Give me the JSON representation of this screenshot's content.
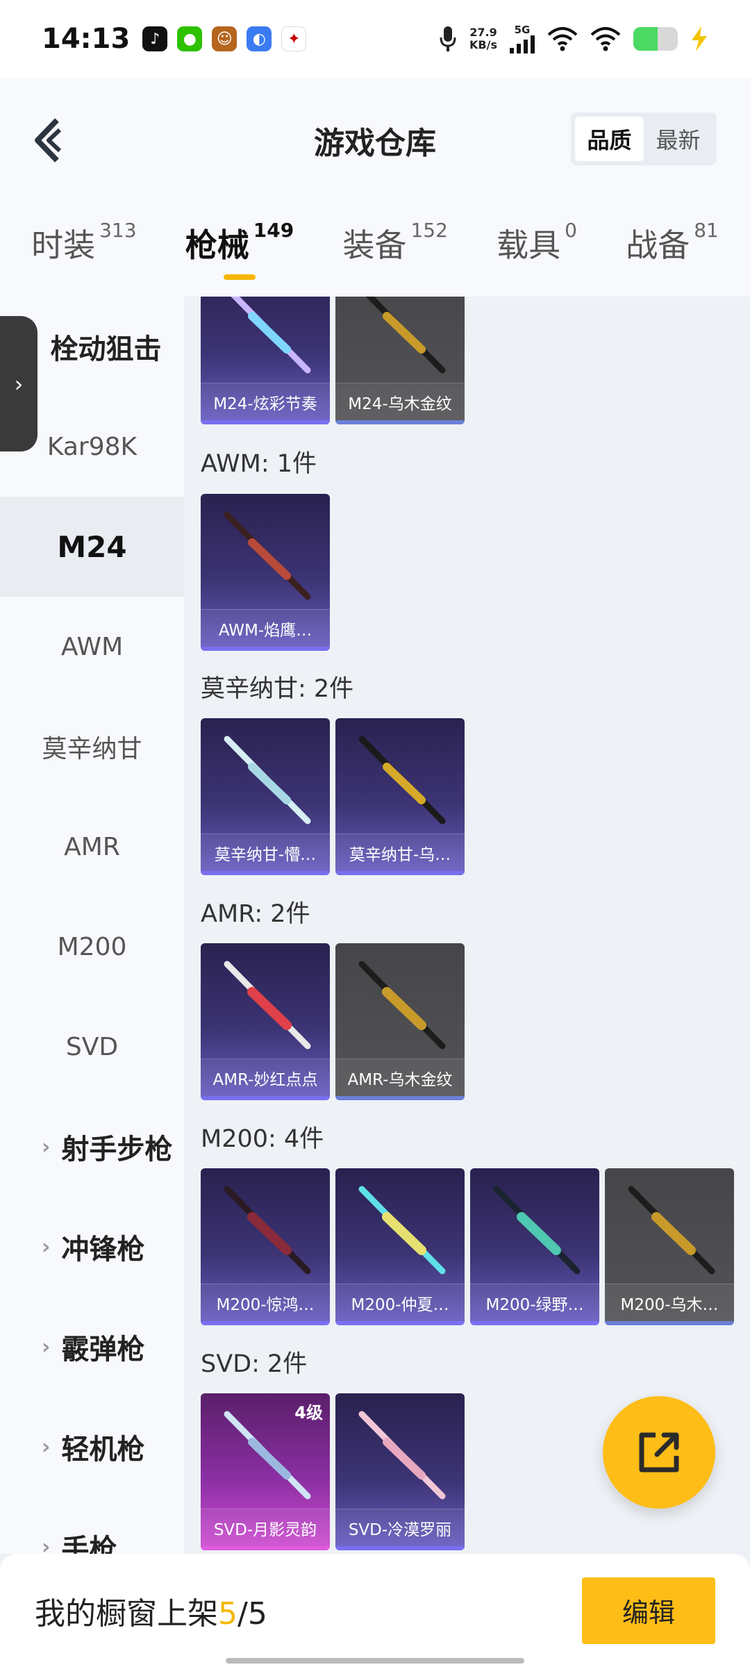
{
  "status_bar": {
    "time": "14:13",
    "net_speed_value": "27.9",
    "net_speed_unit": "KB/s",
    "network": "5G",
    "battery_level": 0.55,
    "icons": [
      "tiktok-icon",
      "wechat-icon",
      "game-avatar-icon",
      "browser-icon",
      "game-logo-icon",
      "mic-icon",
      "signal-icon",
      "wifi-icon",
      "battery-icon",
      "charging-icon"
    ]
  },
  "header": {
    "title": "游戏仓库",
    "sort_options": [
      "品质",
      "最新"
    ],
    "sort_selected": "品质"
  },
  "tabs": [
    {
      "label": "时装",
      "count": "313"
    },
    {
      "label": "枪械",
      "count": "149",
      "active": true
    },
    {
      "label": "装备",
      "count": "152"
    },
    {
      "label": "载具",
      "count": "0"
    },
    {
      "label": "战备",
      "count": "81"
    }
  ],
  "sidenav": [
    {
      "label": "栓动狙击",
      "type": "group-open"
    },
    {
      "label": "Kar98K",
      "type": "item"
    },
    {
      "label": "M24",
      "type": "item",
      "selected": true
    },
    {
      "label": "AWM",
      "type": "item"
    },
    {
      "label": "莫辛纳甘",
      "type": "item"
    },
    {
      "label": "AMR",
      "type": "item"
    },
    {
      "label": "M200",
      "type": "item"
    },
    {
      "label": "SVD",
      "type": "item"
    },
    {
      "label": "射手步枪",
      "type": "group"
    },
    {
      "label": "冲锋枪",
      "type": "group"
    },
    {
      "label": "霰弹枪",
      "type": "group"
    },
    {
      "label": "轻机枪",
      "type": "group"
    },
    {
      "label": "手枪",
      "type": "group"
    }
  ],
  "sections": [
    {
      "title": "",
      "items": [
        {
          "name": "M24-炫彩节奏",
          "quality": "purple"
        },
        {
          "name": "M24-乌木金纹",
          "quality": "gray"
        }
      ]
    },
    {
      "title": "AWM: 1件",
      "items": [
        {
          "name": "AWM-焰鹰…",
          "quality": "purple"
        }
      ]
    },
    {
      "title": "莫辛纳甘: 2件",
      "items": [
        {
          "name": "莫辛纳甘-懵…",
          "quality": "purple"
        },
        {
          "name": "莫辛纳甘-乌…",
          "quality": "purple"
        }
      ]
    },
    {
      "title": "AMR: 2件",
      "items": [
        {
          "name": "AMR-妙红点点",
          "quality": "purple"
        },
        {
          "name": "AMR-乌木金纹",
          "quality": "gray"
        }
      ]
    },
    {
      "title": "M200: 4件",
      "items": [
        {
          "name": "M200-惊鸿…",
          "quality": "purple"
        },
        {
          "name": "M200-仲夏…",
          "quality": "purple"
        },
        {
          "name": "M200-绿野…",
          "quality": "purple"
        },
        {
          "name": "M200-乌木…",
          "quality": "gray"
        }
      ]
    },
    {
      "title": "SVD: 2件",
      "items": [
        {
          "name": "SVD-月影灵韵",
          "quality": "pink",
          "level": "4级"
        },
        {
          "name": "SVD-冷漠罗丽",
          "quality": "purple"
        }
      ]
    }
  ],
  "bottom": {
    "shelf_label": "我的橱窗上架",
    "shelf_current": "5",
    "shelf_sep": "/",
    "shelf_total": "5",
    "edit_label": "编辑"
  },
  "colors": {
    "accent": "#ffbd17",
    "tab_underline": "#f5b800",
    "purple_card": "#3c3474",
    "gray_card": "#545458",
    "pink_card": "#8b2fa4"
  }
}
